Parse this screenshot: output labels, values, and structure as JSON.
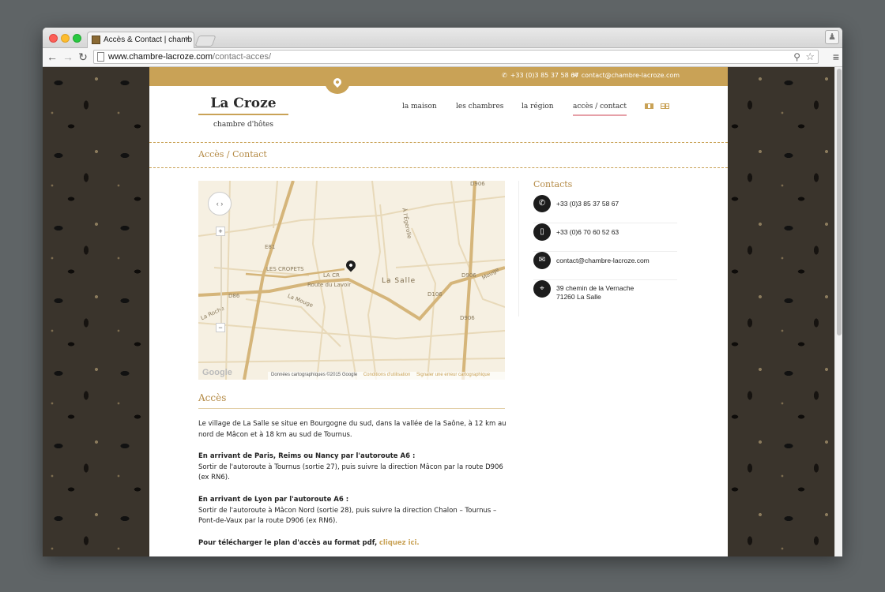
{
  "browser": {
    "tab_title": "Accès & Contact | chamb",
    "tab_close": "×",
    "url_host": "www.chambre-lacroze.com",
    "url_path": "/contact-acces/",
    "back": "←",
    "forward": "→",
    "reload": "↻",
    "zoom": "⚲",
    "star": "☆",
    "menu": "≡",
    "profile": "♟"
  },
  "topbar": {
    "phone": "+33 (0)3 85 37 58 67",
    "email": "contact@chambre-lacroze.com",
    "phone_icon": "✆",
    "email_icon": "✉"
  },
  "logo": {
    "name": "La Croze",
    "tagline": "chambre d'hôtes"
  },
  "nav": [
    {
      "label": "la maison"
    },
    {
      "label": "les chambres"
    },
    {
      "label": "la région"
    },
    {
      "label": "accès / contact"
    }
  ],
  "page_title": "Accès / Contact",
  "map": {
    "labels": {
      "d906_top": "D906",
      "les_cropets": "LES CROPETS",
      "la_cr": "LA CR",
      "route_du_lavoir": "Route du Lavoir",
      "la_salle": "La Salle",
      "la_mouge": "La Mouge",
      "d86": "D86",
      "d906_mid": "D906",
      "d906_low": "D906",
      "d106": "D106",
      "la_roche": "La Roche",
      "mouge": "Mouge",
      "e81": "E81",
      "liegerolle": "À l'Égerolle"
    },
    "pan": "‹ ›",
    "zoom_in": "+",
    "zoom_out": "−",
    "google": "Google",
    "attribution": "Données cartographiques ©2015 Google",
    "terms": "Conditions d'utilisation",
    "report": "Signaler une erreur cartographique"
  },
  "contacts": {
    "title": "Contacts",
    "items": [
      {
        "icon": "✆",
        "text": "+33 (0)3 85 37 58 67"
      },
      {
        "icon": "▯",
        "text": "+33 (0)6 70 60 52 63"
      },
      {
        "icon": "✉",
        "text": "contact@chambre-lacroze.com"
      },
      {
        "icon": "⌖",
        "line1": "39 chemin de la Vernache",
        "line2": "71260 La Salle"
      }
    ]
  },
  "acces": {
    "title": "Accès",
    "intro": "Le village de La Salle se situe en Bourgogne du sud, dans la vallée de la Saône, à 12 km au nord de Mâcon et à 18 km au sud de Tournus.",
    "paris_heading": "En arrivant de Paris, Reims ou Nancy par l'autoroute A6 :",
    "paris_text": "Sortir de l'autoroute à Tournus (sortie 27), puis suivre la direction Mâcon par la route D906 (ex RN6).",
    "lyon_heading": "En arrivant de Lyon par l'autoroute A6 :",
    "lyon_text": "Sortir de l'autoroute à Mâcon Nord (sortie 28), puis suivre la direction Chalon – Tournus – Pont-de-Vaux par la route D906 (ex RN6).",
    "pdf_text": "Pour télécharger le plan d'accès au format pdf,",
    "pdf_link": "cliquez ici."
  }
}
